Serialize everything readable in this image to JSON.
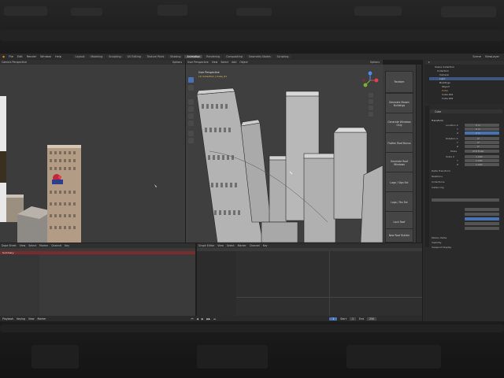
{
  "menubar": {
    "menus": [
      "File",
      "Edit",
      "Render",
      "Window",
      "Help"
    ],
    "workspace_tabs": [
      "Layout",
      "Modeling",
      "Sculpting",
      "UV Editing",
      "Texture Paint",
      "Shading",
      "Animation",
      "Rendering",
      "Compositing",
      "Geometry Nodes",
      "Scripting"
    ],
    "active_tab": "Animation",
    "scene_label": "Scene",
    "view_layer_label": "ViewLayer"
  },
  "viewport_left": {
    "header_items": [
      "Camera Perspective"
    ],
    "options_label": "Options"
  },
  "viewport_right": {
    "header_items": [
      "User Perspective",
      "View",
      "Select",
      "Add",
      "Object"
    ],
    "overlay_title": "User Perspective",
    "overlay_subtitle": "(1) Collection | Cube_01",
    "options_label": "Options"
  },
  "sidebar_buttons": [
    "Random",
    "Generate Mosaic Buildings",
    "Generate Windows Only",
    "Flatten Roof Bonus",
    "Generate Roof Windows",
    "Logo / Sign Ext",
    "Logo / Tex Ext",
    "Lock Roof",
    "New Roof Builder"
  ],
  "outliner": {
    "items": [
      "Scene Collection",
      "Collection",
      "Camera",
      "Light",
      "Buildings",
      "Object",
      "Cube",
      "Cube.001",
      "Cube.002",
      "Cube.003"
    ]
  },
  "properties": {
    "panel_title": "Cube",
    "sections": [
      "Transform",
      "Delta Transform",
      "Relations",
      "Collections",
      "Instancing",
      "Motion Paths",
      "Visibility",
      "Viewport Display"
    ],
    "fields": [
      {
        "label": "Location X",
        "value": "0 m"
      },
      {
        "label": "Y",
        "value": "0 m"
      },
      {
        "label": "Z",
        "value": "0 m"
      },
      {
        "label": "Rotation X",
        "value": "0°"
      },
      {
        "label": "Y",
        "value": "0°"
      },
      {
        "label": "Z",
        "value": "0°"
      },
      {
        "label": "Mode",
        "value": "XYZ Euler"
      },
      {
        "label": "Scale X",
        "value": "1.000"
      },
      {
        "label": "Y",
        "value": "1.000"
      },
      {
        "label": "Z",
        "value": "1.000"
      }
    ]
  },
  "dopesheet": {
    "header_items": [
      "Dope Sheet",
      "View",
      "Select",
      "Marker",
      "Channel",
      "Key"
    ],
    "summary_label": "Summary"
  },
  "graph": {
    "header_items": [
      "Graph Editor",
      "View",
      "Select",
      "Marker",
      "Channel",
      "Key"
    ]
  },
  "timeline": {
    "header_items": [
      "Playback",
      "Keying",
      "View",
      "Marker"
    ],
    "current_frame": "1",
    "start_label": "Start",
    "start_value": "1",
    "end_label": "End",
    "end_value": "250"
  },
  "colors": {
    "accent": "#4772b3",
    "active_tab": "#4a4a4a",
    "playhead": "#ff3b3b"
  }
}
